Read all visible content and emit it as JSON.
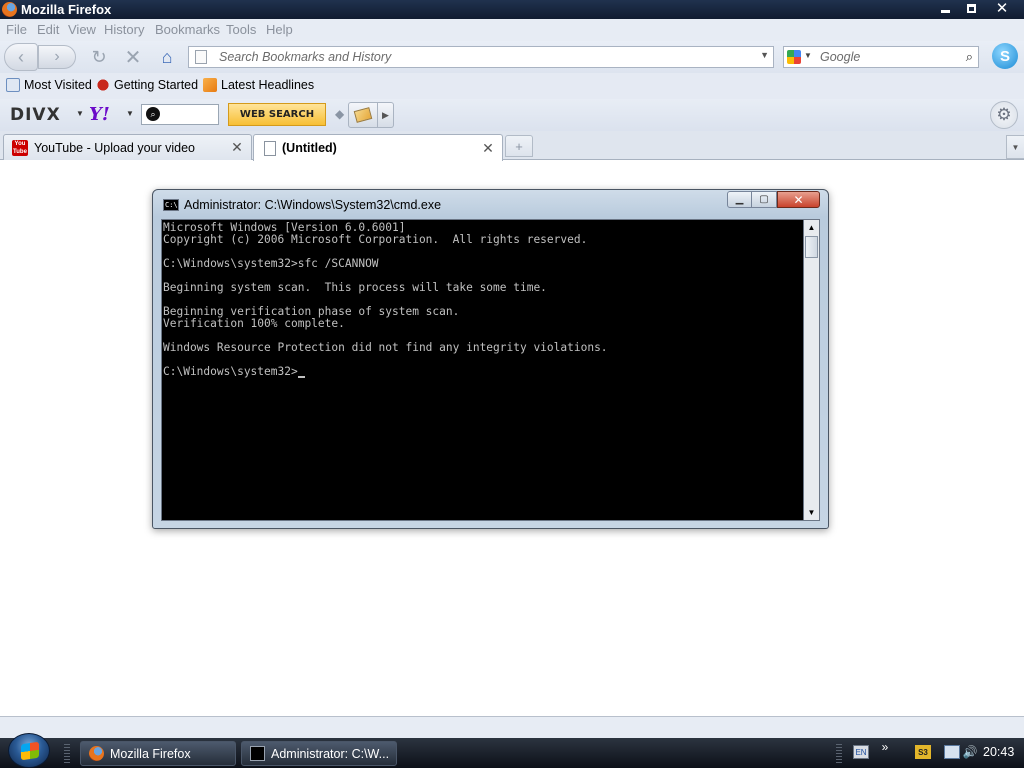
{
  "window": {
    "title": "Mozilla Firefox",
    "min_label": "",
    "close_label": "✕"
  },
  "menubar": {
    "file": "File",
    "edit": "Edit",
    "view": "View",
    "history": "History",
    "bookmarks": "Bookmarks",
    "tools": "Tools",
    "help": "Help"
  },
  "navbar": {
    "back_icon": "‹",
    "forward_icon": "›",
    "reload_icon": "↻",
    "stop_icon": "✕",
    "home_icon": "⌂",
    "url_placeholder": "Search Bookmarks and History",
    "url_dropdown": "▼",
    "search_placeholder": "Google",
    "search_dropdown": "▼",
    "search_icon": "⌕",
    "skype_icon": "S"
  },
  "bookmarks": {
    "items": [
      {
        "label": "Most Visited",
        "icon": "most-visited-icon"
      },
      {
        "label": "Getting Started",
        "icon": "getting-started-icon"
      },
      {
        "label": "Latest Headlines",
        "icon": "rss-icon"
      }
    ]
  },
  "divx_toolbar": {
    "divx_logo": "DIVX",
    "divx_dropdown": "▼",
    "yahoo_logo": "Y!",
    "yahoo_dropdown": "▼",
    "yahoo_search_icon": "⌕",
    "web_search_label": "WEB SEARCH",
    "separator": "◆",
    "more_arrow": "▶",
    "gear_icon": "⚙"
  },
  "tabs": {
    "items": [
      {
        "label": "YouTube - Upload your video",
        "active": false,
        "close": "✕",
        "favicon_text": "You\nTube"
      },
      {
        "label": "(Untitled)",
        "active": true,
        "close": "✕"
      }
    ],
    "new_tab": "+",
    "list_all": "▼"
  },
  "cmd": {
    "title": "Administrator: C:\\Windows\\System32\\cmd.exe",
    "icon_text": "C:\\",
    "min_icon": "▁",
    "max_icon": "▢",
    "close_icon": "✕",
    "lines": [
      "Microsoft Windows [Version 6.0.6001]",
      "Copyright (c) 2006 Microsoft Corporation.  All rights reserved.",
      "",
      "C:\\Windows\\system32>sfc /SCANNOW",
      "",
      "Beginning system scan.  This process will take some time.",
      "",
      "Beginning verification phase of system scan.",
      "Verification 100% complete.",
      "",
      "Windows Resource Protection did not find any integrity violations.",
      "",
      "C:\\Windows\\system32>"
    ],
    "scroll_up": "▲",
    "scroll_down": "▼"
  },
  "taskbar": {
    "buttons": [
      {
        "label": "Mozilla Firefox",
        "icon": "firefox-icon"
      },
      {
        "label": "Administrator: C:\\W...",
        "icon": "cmd-icon"
      }
    ],
    "tray": {
      "keyboard": "EN",
      "chevron": "»",
      "s3": "S3",
      "network": "",
      "volume": "🔊"
    },
    "clock": "20:43"
  }
}
